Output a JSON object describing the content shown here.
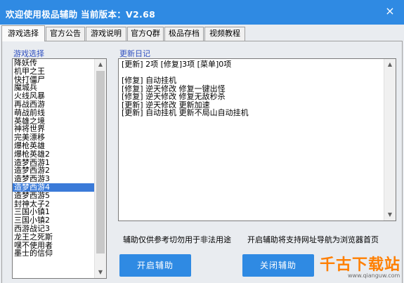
{
  "window": {
    "title": "欢迎使用极品辅助  当前版本：V2.68",
    "close_glyph": "×"
  },
  "tabs": [
    {
      "label": "游戏选择",
      "active": true
    },
    {
      "label": "官方公告"
    },
    {
      "label": "游戏说明"
    },
    {
      "label": "官方Q群"
    },
    {
      "label": "极品存档"
    },
    {
      "label": "视频教程"
    }
  ],
  "game_list": {
    "label": "游戏选择",
    "items": [
      "降妖传",
      "机甲之王",
      "快打僵尸",
      "魔城兵",
      "火线风暴",
      "再战西游",
      "萌战前线",
      "英雄之境",
      "神将世界",
      "完美漂移",
      "爆枪英雄",
      "爆枪英雄2",
      "造梦西游1",
      "造梦西游2",
      "造梦西游3",
      "造梦西游4",
      "造梦西游5",
      "封神太子2",
      "三国小镇1",
      "三国小镇2",
      "西游战记3",
      "龙王之死斯",
      "嘿不使用者",
      "墨士的信仰"
    ],
    "selected_index": 15
  },
  "update_log": {
    "label": "更新日记",
    "lines": [
      "[更新] 2项 [修复]3项 [菜单]0项",
      "",
      "[修复] 自动挂机",
      "[修复] 逆天修改 修复一键出怪",
      "[修复] 逆天修改 修复无敌秒杀",
      "[更新] 逆天修改 更新加速",
      "[更新] 自动挂机 更新不局山自动挂机"
    ]
  },
  "notices": {
    "left": "辅助仅供参考切勿用于非法用途",
    "right": "开启辅助将支持网址导航为浏览器首页"
  },
  "buttons": {
    "start": "开启辅助",
    "stop": "关闭辅助"
  },
  "watermark": {
    "text": "千古下载站",
    "sub": "www.qianguw.com"
  }
}
